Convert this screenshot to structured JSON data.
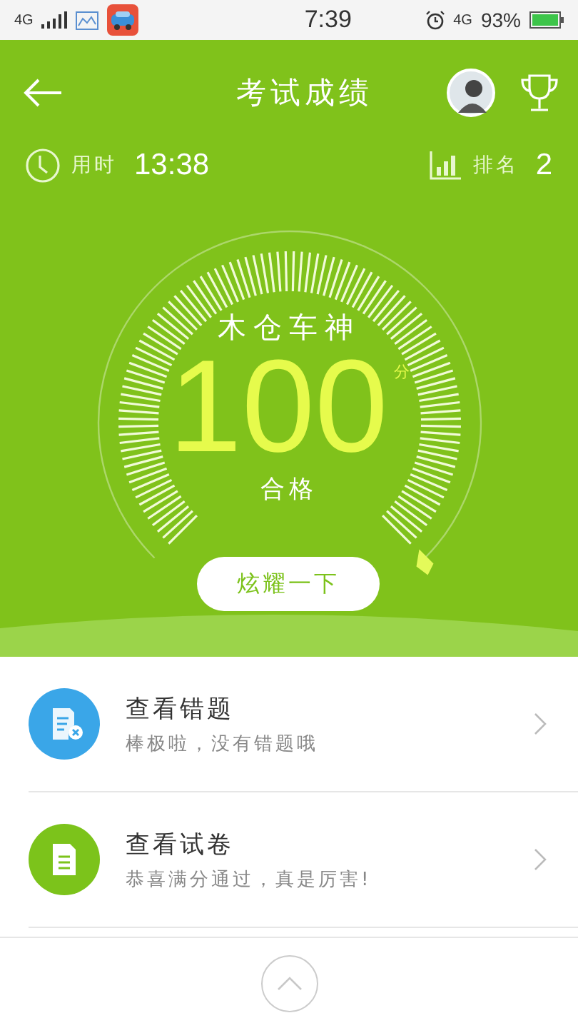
{
  "status_bar": {
    "network": "4G",
    "time": "7:39",
    "data_network": "4G",
    "battery": "93%"
  },
  "header": {
    "title": "考试成绩"
  },
  "stats": {
    "time_label": "用时",
    "time_value": "13:38",
    "rank_label": "排名",
    "rank_value": "2"
  },
  "gauge": {
    "title": "木仓车神",
    "score": "100",
    "unit": "分",
    "result": "合格",
    "share_button": "炫耀一下"
  },
  "items": [
    {
      "kind": "wrong",
      "color": "#3aa6e8",
      "title": "查看错题",
      "subtitle": "棒极啦，没有错题哦"
    },
    {
      "kind": "paper",
      "color": "#7cc31b",
      "title": "查看试卷",
      "subtitle": "恭喜满分通过，真是厉害!"
    }
  ]
}
